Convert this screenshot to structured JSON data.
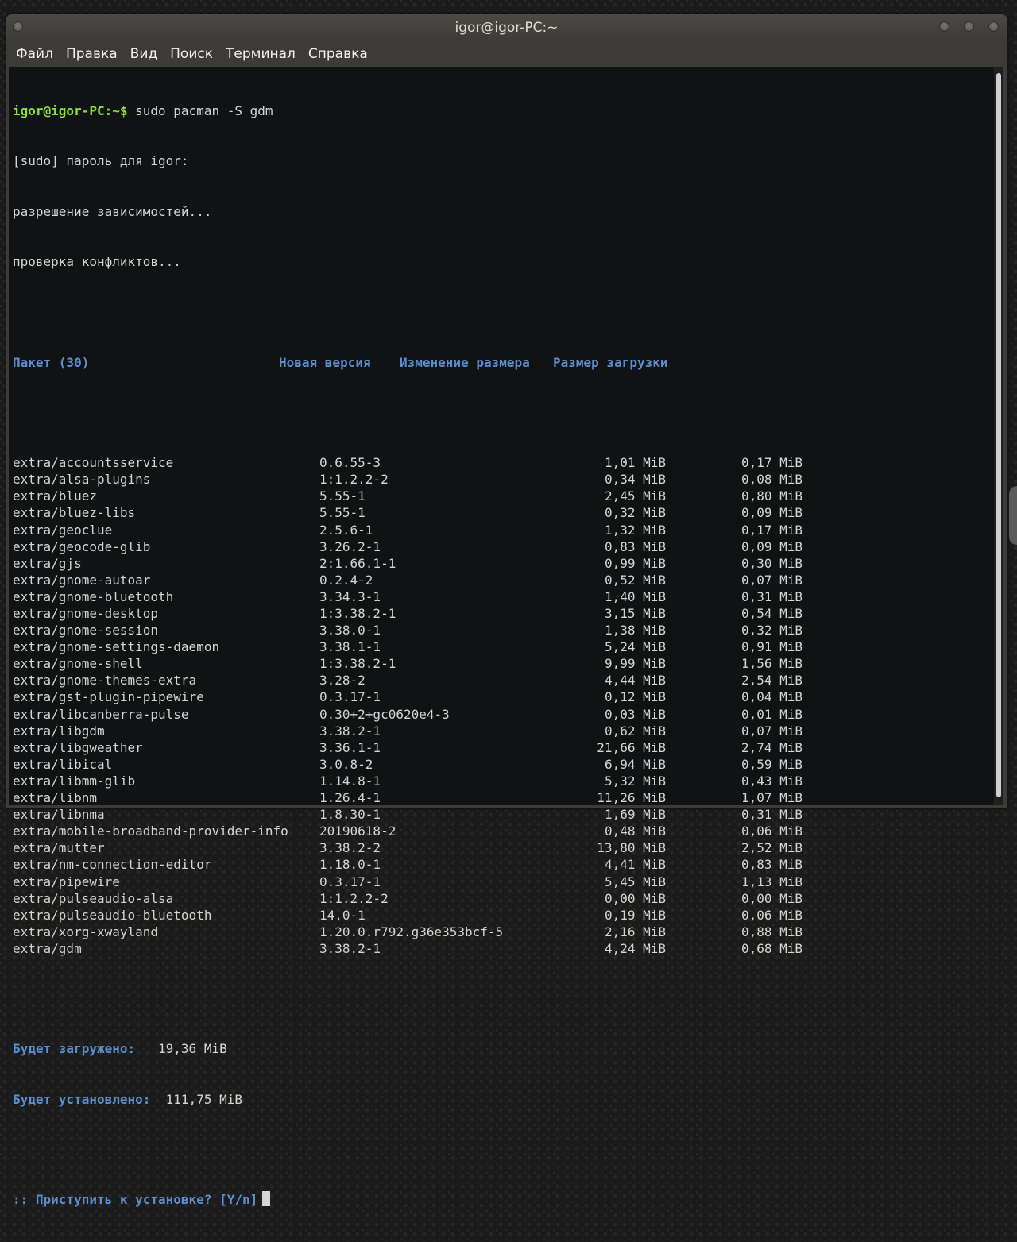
{
  "window": {
    "title": "igor@igor-PC:~"
  },
  "menu": [
    "Файл",
    "Правка",
    "Вид",
    "Поиск",
    "Терминал",
    "Справка"
  ],
  "terminal": {
    "prompt": "igor@igor-PC:~$",
    "command": " sudo pacman -S gdm",
    "output_lines": [
      "[sudo] пароль для igor:",
      "разрешение зависимостей...",
      "проверка конфликтов..."
    ],
    "table_header": {
      "package": "Пакет (30)",
      "new_version": "Новая версия",
      "size_change": "Изменение размера",
      "download_size": "Размер загрузки"
    },
    "packages": [
      {
        "name": "extra/accountsservice",
        "version": "0.6.55-3",
        "size": "1,01 MiB",
        "download": "0,17 MiB"
      },
      {
        "name": "extra/alsa-plugins",
        "version": "1:1.2.2-2",
        "size": "0,34 MiB",
        "download": "0,08 MiB"
      },
      {
        "name": "extra/bluez",
        "version": "5.55-1",
        "size": "2,45 MiB",
        "download": "0,80 MiB"
      },
      {
        "name": "extra/bluez-libs",
        "version": "5.55-1",
        "size": "0,32 MiB",
        "download": "0,09 MiB"
      },
      {
        "name": "extra/geoclue",
        "version": "2.5.6-1",
        "size": "1,32 MiB",
        "download": "0,17 MiB"
      },
      {
        "name": "extra/geocode-glib",
        "version": "3.26.2-1",
        "size": "0,83 MiB",
        "download": "0,09 MiB"
      },
      {
        "name": "extra/gjs",
        "version": "2:1.66.1-1",
        "size": "0,99 MiB",
        "download": "0,30 MiB"
      },
      {
        "name": "extra/gnome-autoar",
        "version": "0.2.4-2",
        "size": "0,52 MiB",
        "download": "0,07 MiB"
      },
      {
        "name": "extra/gnome-bluetooth",
        "version": "3.34.3-1",
        "size": "1,40 MiB",
        "download": "0,31 MiB"
      },
      {
        "name": "extra/gnome-desktop",
        "version": "1:3.38.2-1",
        "size": "3,15 MiB",
        "download": "0,54 MiB"
      },
      {
        "name": "extra/gnome-session",
        "version": "3.38.0-1",
        "size": "1,38 MiB",
        "download": "0,32 MiB"
      },
      {
        "name": "extra/gnome-settings-daemon",
        "version": "3.38.1-1",
        "size": "5,24 MiB",
        "download": "0,91 MiB"
      },
      {
        "name": "extra/gnome-shell",
        "version": "1:3.38.2-1",
        "size": "9,99 MiB",
        "download": "1,56 MiB"
      },
      {
        "name": "extra/gnome-themes-extra",
        "version": "3.28-2",
        "size": "4,44 MiB",
        "download": "2,54 MiB"
      },
      {
        "name": "extra/gst-plugin-pipewire",
        "version": "0.3.17-1",
        "size": "0,12 MiB",
        "download": "0,04 MiB"
      },
      {
        "name": "extra/libcanberra-pulse",
        "version": "0.30+2+gc0620e4-3",
        "size": "0,03 MiB",
        "download": "0,01 MiB"
      },
      {
        "name": "extra/libgdm",
        "version": "3.38.2-1",
        "size": "0,62 MiB",
        "download": "0,07 MiB"
      },
      {
        "name": "extra/libgweather",
        "version": "3.36.1-1",
        "size": "21,66 MiB",
        "download": "2,74 MiB"
      },
      {
        "name": "extra/libical",
        "version": "3.0.8-2",
        "size": "6,94 MiB",
        "download": "0,59 MiB"
      },
      {
        "name": "extra/libmm-glib",
        "version": "1.14.8-1",
        "size": "5,32 MiB",
        "download": "0,43 MiB"
      },
      {
        "name": "extra/libnm",
        "version": "1.26.4-1",
        "size": "11,26 MiB",
        "download": "1,07 MiB"
      },
      {
        "name": "extra/libnma",
        "version": "1.8.30-1",
        "size": "1,69 MiB",
        "download": "0,31 MiB"
      },
      {
        "name": "extra/mobile-broadband-provider-info",
        "version": "20190618-2",
        "size": "0,48 MiB",
        "download": "0,06 MiB"
      },
      {
        "name": "extra/mutter",
        "version": "3.38.2-2",
        "size": "13,80 MiB",
        "download": "2,52 MiB"
      },
      {
        "name": "extra/nm-connection-editor",
        "version": "1.18.0-1",
        "size": "4,41 MiB",
        "download": "0,83 MiB"
      },
      {
        "name": "extra/pipewire",
        "version": "0.3.17-1",
        "size": "5,45 MiB",
        "download": "1,13 MiB"
      },
      {
        "name": "extra/pulseaudio-alsa",
        "version": "1:1.2.2-2",
        "size": "0,00 MiB",
        "download": "0,00 MiB"
      },
      {
        "name": "extra/pulseaudio-bluetooth",
        "version": "14.0-1",
        "size": "0,19 MiB",
        "download": "0,06 MiB"
      },
      {
        "name": "extra/xorg-xwayland",
        "version": "1.20.0.r792.g36e353bcf-5",
        "size": "2,16 MiB",
        "download": "0,88 MiB"
      },
      {
        "name": "extra/gdm",
        "version": "3.38.2-1",
        "size": "4,24 MiB",
        "download": "0,68 MiB"
      }
    ],
    "summary": {
      "download_label": "Будет загружено:",
      "download_value": "   19,36 MiB",
      "install_label": "Будет установлено:",
      "install_value": "  111,75 MiB"
    },
    "question": ":: Приступить к установке? [Y/n]",
    "colors": {
      "prompt": "#8ae234",
      "header": "#5b8fd0",
      "text": "#d3d7cf",
      "background": "#111213"
    }
  }
}
